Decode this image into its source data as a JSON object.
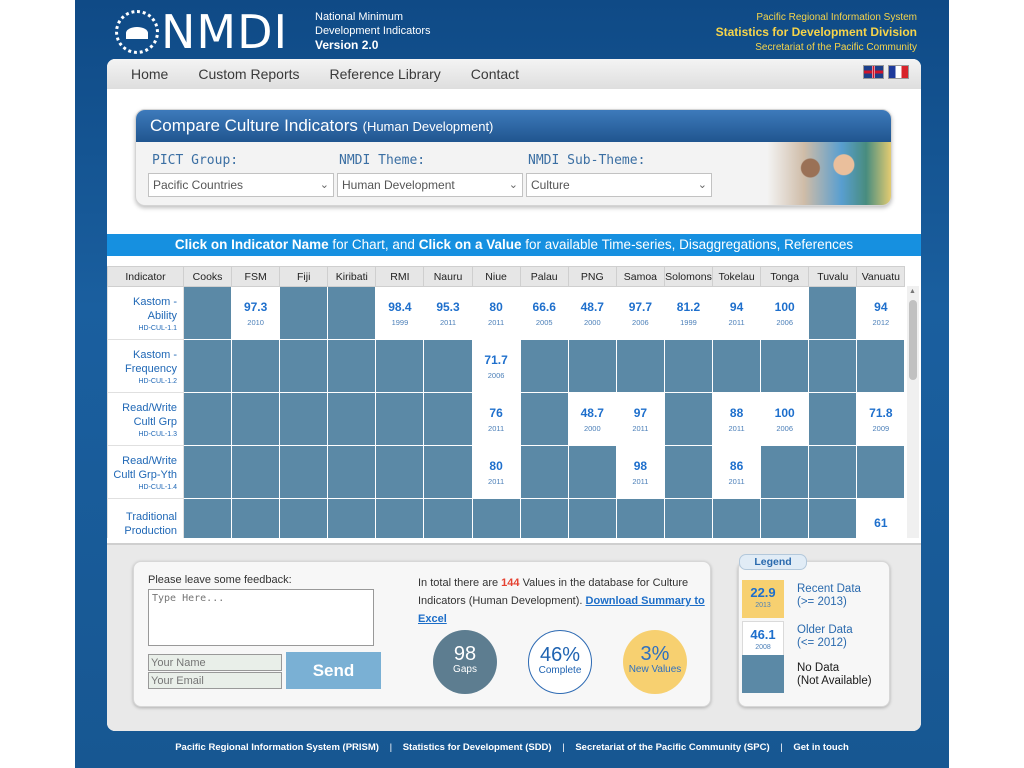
{
  "header": {
    "logo_text": "NMDI",
    "logo_line1": "National Minimum",
    "logo_line2": "Development Indicators",
    "version": "Version 2.0",
    "right_line1": "Pacific Regional Information System",
    "right_line2": "Statistics for Development Division",
    "right_line3": "Secretariat of the Pacific Community"
  },
  "nav": {
    "items": [
      "Home",
      "Custom Reports",
      "Reference Library",
      "Contact"
    ],
    "flags": [
      "uk-flag",
      "france-flag"
    ]
  },
  "selector": {
    "title": "Compare Culture Indicators",
    "title_sub": "(Human Development)",
    "pict_label": "PICT Group:",
    "theme_label": "NMDI Theme:",
    "subtheme_label": "NMDI Sub-Theme:",
    "pict_value": "Pacific Countries",
    "theme_value": "Human Development",
    "subtheme_value": "Culture"
  },
  "instruction": {
    "bold1": "Click on Indicator Name",
    "text1": "for Chart, and",
    "bold2": "Click on a Value",
    "text2": "for available Time-series, Disaggregations, References"
  },
  "table": {
    "columns": [
      "Indicator",
      "Cooks",
      "FSM",
      "Fiji",
      "Kiribati",
      "RMI",
      "Nauru",
      "Niue",
      "Palau",
      "PNG",
      "Samoa",
      "Solomons",
      "Tokelau",
      "Tonga",
      "Tuvalu",
      "Vanuatu"
    ],
    "rows": [
      {
        "name": "Kastom - Ability",
        "code": "HD-CUL-1.1",
        "cells": [
          null,
          {
            "v": "97.3",
            "y": "2010"
          },
          null,
          null,
          {
            "v": "98.4",
            "y": "1999"
          },
          {
            "v": "95.3",
            "y": "2011"
          },
          {
            "v": "80",
            "y": "2011"
          },
          {
            "v": "66.6",
            "y": "2005"
          },
          {
            "v": "48.7",
            "y": "2000"
          },
          {
            "v": "97.7",
            "y": "2006"
          },
          {
            "v": "81.2",
            "y": "1999"
          },
          {
            "v": "94",
            "y": "2011"
          },
          {
            "v": "100",
            "y": "2006"
          },
          null,
          {
            "v": "94",
            "y": "2012"
          }
        ]
      },
      {
        "name": "Kastom - Frequency",
        "code": "HD-CUL-1.2",
        "cells": [
          null,
          null,
          null,
          null,
          null,
          null,
          {
            "v": "71.7",
            "y": "2006"
          },
          null,
          null,
          null,
          null,
          null,
          null,
          null,
          null
        ]
      },
      {
        "name": "Read/Write Cultl Grp",
        "code": "HD-CUL-1.3",
        "cells": [
          null,
          null,
          null,
          null,
          null,
          null,
          {
            "v": "76",
            "y": "2011"
          },
          null,
          {
            "v": "48.7",
            "y": "2000"
          },
          {
            "v": "97",
            "y": "2011"
          },
          null,
          {
            "v": "88",
            "y": "2011"
          },
          {
            "v": "100",
            "y": "2006"
          },
          null,
          {
            "v": "71.8",
            "y": "2009"
          }
        ]
      },
      {
        "name": "Read/Write Cultl Grp-Yth",
        "code": "HD-CUL-1.4",
        "cells": [
          null,
          null,
          null,
          null,
          null,
          null,
          {
            "v": "80",
            "y": "2011"
          },
          null,
          null,
          {
            "v": "98",
            "y": "2011"
          },
          null,
          {
            "v": "86",
            "y": "2011"
          },
          null,
          null,
          null
        ]
      },
      {
        "name": "Traditional Production",
        "code": "",
        "cells": [
          null,
          null,
          null,
          null,
          null,
          null,
          null,
          null,
          null,
          null,
          null,
          null,
          null,
          null,
          {
            "v": "61",
            "y": ""
          }
        ]
      }
    ]
  },
  "feedback": {
    "label": "Please leave some feedback:",
    "textarea_placeholder": "Type Here...",
    "name_placeholder": "Your Name",
    "email_placeholder": "Your Email",
    "send_label": "Send"
  },
  "summary": {
    "text_before": "In total there are",
    "count": "144",
    "text_after": "Values in the database for Culture Indicators (Human Development).",
    "download_link": "Download Summary to Excel"
  },
  "stats": {
    "gaps_value": "98",
    "gaps_label": "Gaps",
    "complete_value": "46%",
    "complete_label": "Complete",
    "new_value": "3%",
    "new_label": "New Values"
  },
  "legend": {
    "title": "Legend",
    "recent_value": "22.9",
    "recent_year": "2013",
    "recent_line1": "Recent Data",
    "recent_line2": "(>= 2013)",
    "older_value": "46.1",
    "older_year": "2008",
    "older_line1": "Older Data",
    "older_line2": "(<= 2012)",
    "none_line1": "No Data",
    "none_line2": "(Not Available)"
  },
  "footer": {
    "links": [
      "Pacific Regional Information System (PRISM)",
      "Statistics for Development (SDD)",
      "Secretariat of the Pacific Community (SPC)",
      "Get in touch"
    ],
    "separator": "|"
  },
  "colors": {
    "no_data": "#5b89a6",
    "recent_data": "#f7d070",
    "accent_blue": "#1690e0"
  }
}
